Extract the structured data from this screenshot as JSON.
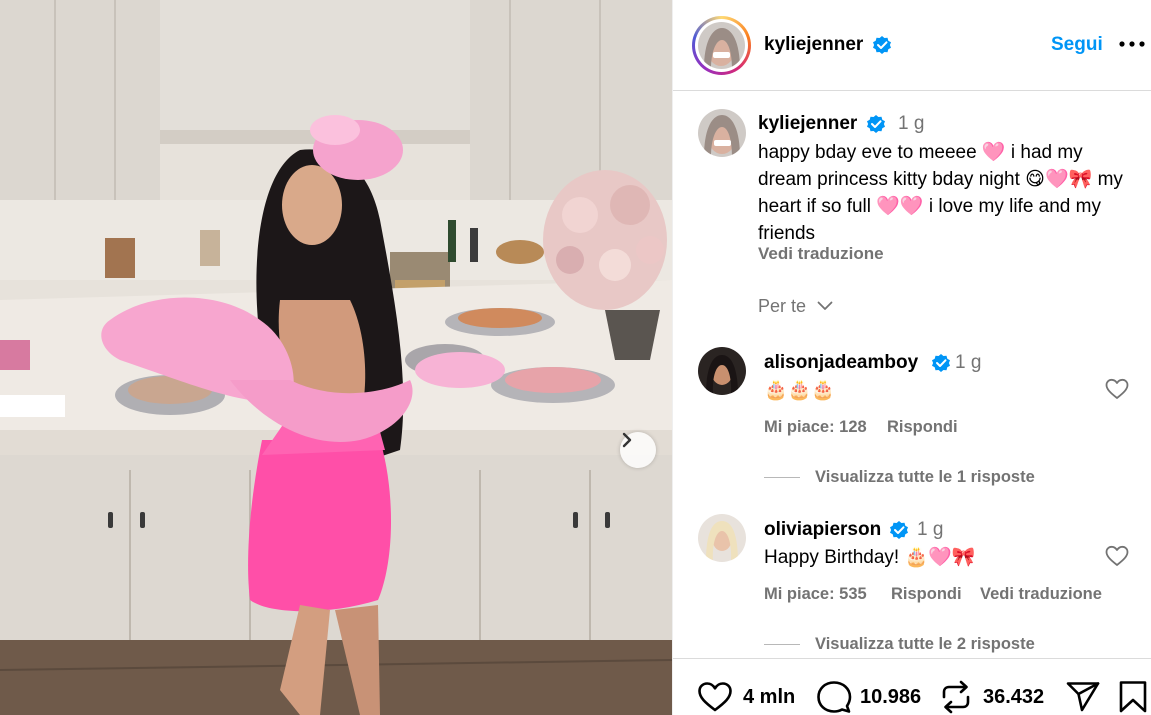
{
  "post": {
    "username": "kyliejenner",
    "follow_label": "Segui",
    "more_label": "•••"
  },
  "caption": {
    "username": "kyliejenner",
    "time": "1 g",
    "text": "happy bday eve to meeee 🩷 i had my dream princess kitty bday night 😋🩷🎀 my heart if so full 🩷🩷 i love my life and my friends",
    "translation_label": "Vedi traduzione"
  },
  "for_you_label": "Per te",
  "comments": [
    {
      "username": "alisonjadeamboy",
      "time": "1 g",
      "text": "🎂🎂🎂",
      "likes_label": "Mi piace: 128",
      "reply_label": "Rispondi",
      "view_replies": "Visualizza tutte le 1 risposte"
    },
    {
      "username": "oliviapierson",
      "time": "1 g",
      "text": "Happy Birthday! 🎂🩷🎀",
      "likes_label": "Mi piace: 535",
      "reply_label": "Rispondi",
      "translation_label": "Vedi traduzione",
      "view_replies": "Visualizza tutte le 2 risposte"
    }
  ],
  "stats": {
    "likes": "4 mln",
    "comments": "10.986",
    "reposts": "36.432"
  },
  "icons": {
    "verified": "verified-badge-icon",
    "heart": "heart-icon",
    "comment": "comment-icon",
    "repost": "repost-icon",
    "share": "share-icon",
    "save": "bookmark-icon",
    "next": "chevron-right-icon"
  },
  "colors": {
    "accent": "#0095f6",
    "secondary_text": "#737373",
    "dress_pink": "#ff4fa8"
  }
}
